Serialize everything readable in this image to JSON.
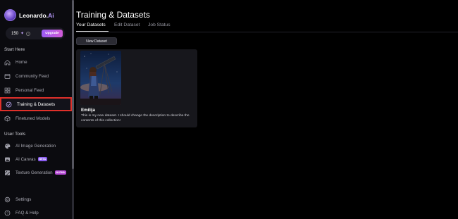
{
  "brand": {
    "name": "Leonardo.",
    "name_suffix": "Ai"
  },
  "credits": {
    "value": "150",
    "token_symbol": "✦",
    "upgrade_label": "Upgrade"
  },
  "sidebar": {
    "start_here_title": "Start Here",
    "start_items": [
      {
        "label": "Home",
        "icon": "home-icon"
      },
      {
        "label": "Community Feed",
        "icon": "community-icon"
      },
      {
        "label": "Personal Feed",
        "icon": "grid-icon"
      },
      {
        "label": "Training & Datasets",
        "icon": "training-icon",
        "active": true
      },
      {
        "label": "Finetuned Models",
        "icon": "cube-icon"
      }
    ],
    "user_tools_title": "User Tools",
    "tool_items": [
      {
        "label": "AI Image Generation",
        "icon": "palette-icon"
      },
      {
        "label": "AI Canvas",
        "icon": "canvas-icon",
        "badge": "BETA"
      },
      {
        "label": "Texture Generation",
        "icon": "texture-icon",
        "badge": "ALPHA"
      }
    ],
    "bottom_items": [
      {
        "label": "Settings",
        "icon": "gear-icon"
      },
      {
        "label": "FAQ & Help",
        "icon": "help-icon"
      }
    ]
  },
  "main": {
    "title": "Training & Datasets",
    "tabs": [
      {
        "label": "Your Datasets",
        "active": true
      },
      {
        "label": "Edit Dataset"
      },
      {
        "label": "Job Status"
      }
    ],
    "new_dataset_label": "New Dataset",
    "datasets": [
      {
        "name": "Emilija",
        "description": "This is my new dataset. I should change the description to describe the contents of this collection!"
      }
    ]
  },
  "colors": {
    "accent": "#9b5cf6",
    "highlight_box": "#e0302a"
  }
}
